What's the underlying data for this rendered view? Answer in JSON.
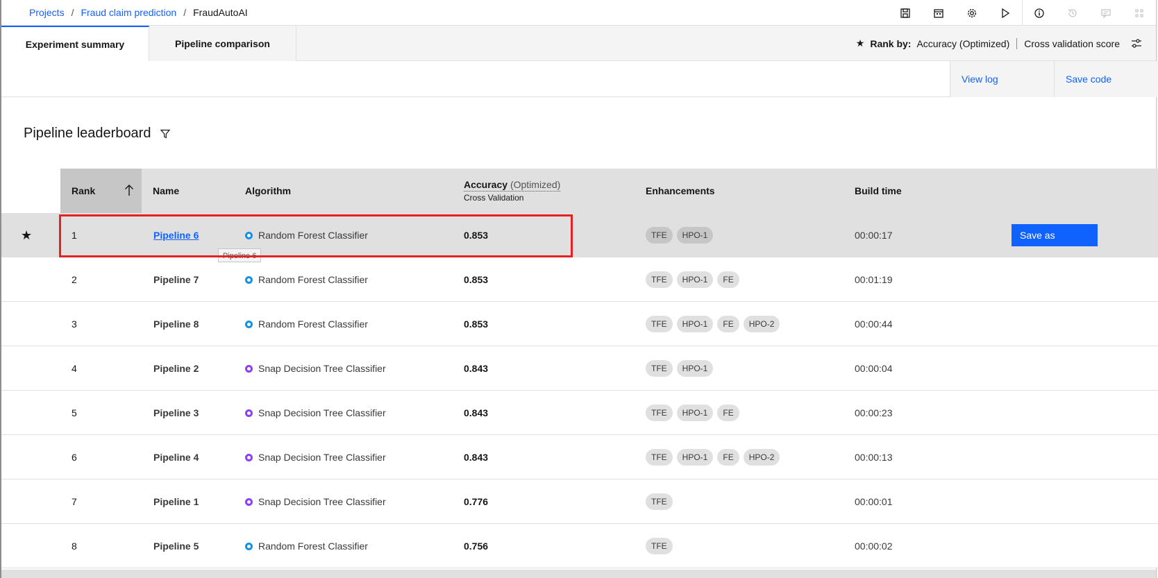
{
  "breadcrumb": {
    "items": [
      "Projects",
      "Fraud claim prediction"
    ],
    "current": "FraudAutoAI",
    "separator": "/"
  },
  "toolbar": {
    "icons": [
      "save-icon",
      "calendar-icon",
      "gear-icon",
      "play-icon",
      "info-icon",
      "history-icon",
      "comment-icon",
      "apps-icon"
    ]
  },
  "tabs": [
    {
      "label": "Experiment summary",
      "active": true
    },
    {
      "label": "Pipeline comparison",
      "active": false
    }
  ],
  "rank_by": {
    "label": "Rank by:",
    "metric": "Accuracy (Optimized)",
    "score": "Cross validation score"
  },
  "actions": {
    "view_log": "View log",
    "save_code": "Save code"
  },
  "leaderboard": {
    "title": "Pipeline leaderboard",
    "columns": {
      "rank": "Rank",
      "name": "Name",
      "algorithm": "Algorithm",
      "accuracy": "Accuracy",
      "accuracy_qualifier": "(Optimized)",
      "accuracy_sub": "Cross Validation",
      "enhancements": "Enhancements",
      "build_time": "Build time"
    },
    "save_as_label": "Save as",
    "tooltip": "Pipeline 6",
    "rows": [
      {
        "rank": "1",
        "name": "Pipeline 6",
        "algorithm": "Random Forest Classifier",
        "algo_color": "#1192e8",
        "accuracy": "0.853",
        "enhancements": [
          "TFE",
          "HPO-1"
        ],
        "build_time": "00:00:17",
        "selected": true
      },
      {
        "rank": "2",
        "name": "Pipeline 7",
        "algorithm": "Random Forest Classifier",
        "algo_color": "#1192e8",
        "accuracy": "0.853",
        "enhancements": [
          "TFE",
          "HPO-1",
          "FE"
        ],
        "build_time": "00:01:19"
      },
      {
        "rank": "3",
        "name": "Pipeline 8",
        "algorithm": "Random Forest Classifier",
        "algo_color": "#1192e8",
        "accuracy": "0.853",
        "enhancements": [
          "TFE",
          "HPO-1",
          "FE",
          "HPO-2"
        ],
        "build_time": "00:00:44"
      },
      {
        "rank": "4",
        "name": "Pipeline 2",
        "algorithm": "Snap Decision Tree Classifier",
        "algo_color": "#8a3ffc",
        "accuracy": "0.843",
        "enhancements": [
          "TFE",
          "HPO-1"
        ],
        "build_time": "00:00:04"
      },
      {
        "rank": "5",
        "name": "Pipeline 3",
        "algorithm": "Snap Decision Tree Classifier",
        "algo_color": "#8a3ffc",
        "accuracy": "0.843",
        "enhancements": [
          "TFE",
          "HPO-1",
          "FE"
        ],
        "build_time": "00:00:23"
      },
      {
        "rank": "6",
        "name": "Pipeline 4",
        "algorithm": "Snap Decision Tree Classifier",
        "algo_color": "#8a3ffc",
        "accuracy": "0.843",
        "enhancements": [
          "TFE",
          "HPO-1",
          "FE",
          "HPO-2"
        ],
        "build_time": "00:00:13"
      },
      {
        "rank": "7",
        "name": "Pipeline 1",
        "algorithm": "Snap Decision Tree Classifier",
        "algo_color": "#8a3ffc",
        "accuracy": "0.776",
        "enhancements": [
          "TFE"
        ],
        "build_time": "00:00:01"
      },
      {
        "rank": "8",
        "name": "Pipeline 5",
        "algorithm": "Random Forest Classifier",
        "algo_color": "#1192e8",
        "accuracy": "0.756",
        "enhancements": [
          "TFE"
        ],
        "build_time": "00:00:02"
      }
    ]
  },
  "colors": {
    "accent": "#0f62fe",
    "highlight": "#e52222"
  }
}
